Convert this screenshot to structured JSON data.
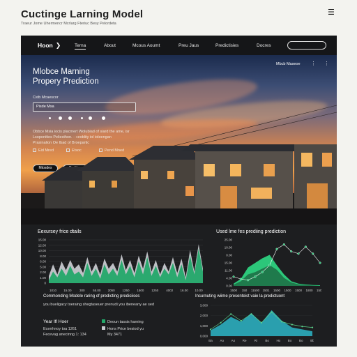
{
  "header": {
    "title": "Cuctinge Larning Model",
    "subtitle": "Traeur Jome Uhermencr Mcrlarg Fteriuc Besy Pelordeta",
    "menu_icon": "hamburger-menu-icon"
  },
  "nav": {
    "home": "Hoon",
    "items": [
      "Terna",
      "About",
      "Mcous Aoumt",
      "Preu Jaus",
      "Predictisies",
      "Docres"
    ],
    "active_index": 0
  },
  "hero": {
    "title_line1": "Mlobce Marning",
    "title_line2": "Propery Prediction",
    "small_label": "Cstb Mcaescor",
    "input_value": "Pisde Msa",
    "description_line1": "Obbce Msia iocis placmert Wolubiad of siard the ame, isr",
    "description_line2": "Lsoponities Peliesthon. · «eoblity iol ioleengan",
    "description_line3": "Prasinalion Oe Ibad of Broepartic",
    "options": [
      "Eid Mred",
      "Etsoc",
      "Pend Mned"
    ],
    "buttons": [
      "Mtosdes",
      "Rediiion"
    ],
    "top_right_label": "Mbcb Maseoe",
    "top_right_dots": "⋮ ⋮"
  },
  "panel_left": {
    "title": "Eexursey frice dtails",
    "chart_data": {
      "type": "area",
      "y_ticks": [
        "15.00",
        "12.00",
        "10.00",
        "8.00",
        "6.00",
        "5.00",
        "2.00",
        "1.00",
        "0"
      ],
      "x_ticks": [
        "1010",
        "15.00",
        "300",
        "55.00",
        "2050",
        "1250",
        "1500",
        "1250",
        "4002",
        "16.00",
        "10.00"
      ],
      "grid": true,
      "series": [
        {
          "color": "#c7c9cf",
          "values": [
            2.5,
            6.5,
            3,
            7.5,
            4.5,
            8,
            5,
            6.5,
            3.5,
            9,
            4,
            7,
            3,
            8.5,
            5,
            7,
            4,
            10,
            4.5,
            8,
            3.5,
            9.5,
            5,
            11,
            4,
            8,
            3,
            7,
            4,
            9,
            3.5,
            8.5,
            2,
            11.5,
            4,
            13.5,
            5
          ]
        },
        {
          "color": "#23a86a",
          "values": [
            1,
            4,
            2,
            5,
            2.5,
            6,
            3,
            4,
            2,
            7,
            2.5,
            5,
            1.5,
            6.5,
            3,
            5,
            2.5,
            8,
            3,
            6,
            2,
            7.5,
            3,
            9,
            2.5,
            6,
            2,
            5,
            3,
            7,
            2,
            6.5,
            1,
            9.5,
            3,
            12,
            4
          ]
        }
      ]
    },
    "bottom_title": "Commonding Modele raring of predicting prediciises",
    "bottom_sub": "you bueligacy toeraing shegtaseuer prenudi you ibeneany ae sed",
    "stats_title": "Year Ifl Hoer",
    "stats_lines": [
      "Ecerrhnoy toa 1261",
      "Fecevag anecinng 1: 134"
    ],
    "legend": [
      {
        "label": "Deoun tassis harning",
        "color": "#23a86a"
      },
      {
        "label": "Hons Price besiod yu",
        "color": "#c7c9cf"
      },
      {
        "label": "My 3471",
        "color": ""
      }
    ]
  },
  "panel_right": {
    "title": "Used lme fes prediing prediction",
    "chart_data": {
      "type": "area",
      "y_ticks": [
        "25.00",
        "10.00",
        "0.00",
        "15.00",
        "11.00",
        "4.00",
        "0.00"
      ],
      "x_ticks": [
        "1500",
        "150",
        "11500",
        "1501",
        "1500",
        "1500",
        "1500",
        "1800",
        "1500"
      ],
      "series": [
        {
          "color": "#2cc77a",
          "values": [
            1,
            3,
            8,
            10,
            12,
            13.5,
            9,
            5,
            2,
            1,
            0.6,
            0.4,
            0.3
          ]
        },
        {
          "color": "#1f7a4c",
          "values": [
            0.5,
            2,
            5,
            6,
            7.5,
            9,
            7,
            3.5,
            1.5,
            0.7,
            0.4,
            0.2,
            0.1
          ]
        }
      ],
      "line": {
        "color": "#ffffff",
        "values": [
          4,
          3,
          2.5,
          4,
          6,
          9,
          16,
          18,
          15,
          14,
          17,
          14,
          10
        ]
      }
    },
    "bottom_title": "Incurnuting wiime presenteist vaie la predictuont",
    "chart2_data": {
      "type": "area",
      "y_ticks": [
        "3,000",
        "2,000",
        "1,000",
        "0,000"
      ],
      "x_ticks": [
        "Ba",
        "Ao",
        "Ao",
        "Re",
        "Ri",
        "Bo",
        "Ho",
        "Bo",
        "Bo",
        "Bb"
      ],
      "series": [
        {
          "color": "#2a9fae",
          "values": [
            0.6,
            1.2,
            2,
            1.5,
            2.4,
            1.4,
            2.7,
            1.6,
            0.9,
            0.7,
            0.5
          ]
        }
      ],
      "line": {
        "color": "#5bd08a",
        "values": [
          0.7,
          1.4,
          2.3,
          1.6,
          2.3,
          1.4,
          2.5,
          1.5,
          1.2,
          1.0,
          0.9
        ]
      }
    }
  },
  "colors": {
    "accent_green": "#23a86a",
    "teal": "#2a9fae",
    "frame_bg": "#1e1f21",
    "page_bg": "#f3f3ef"
  }
}
